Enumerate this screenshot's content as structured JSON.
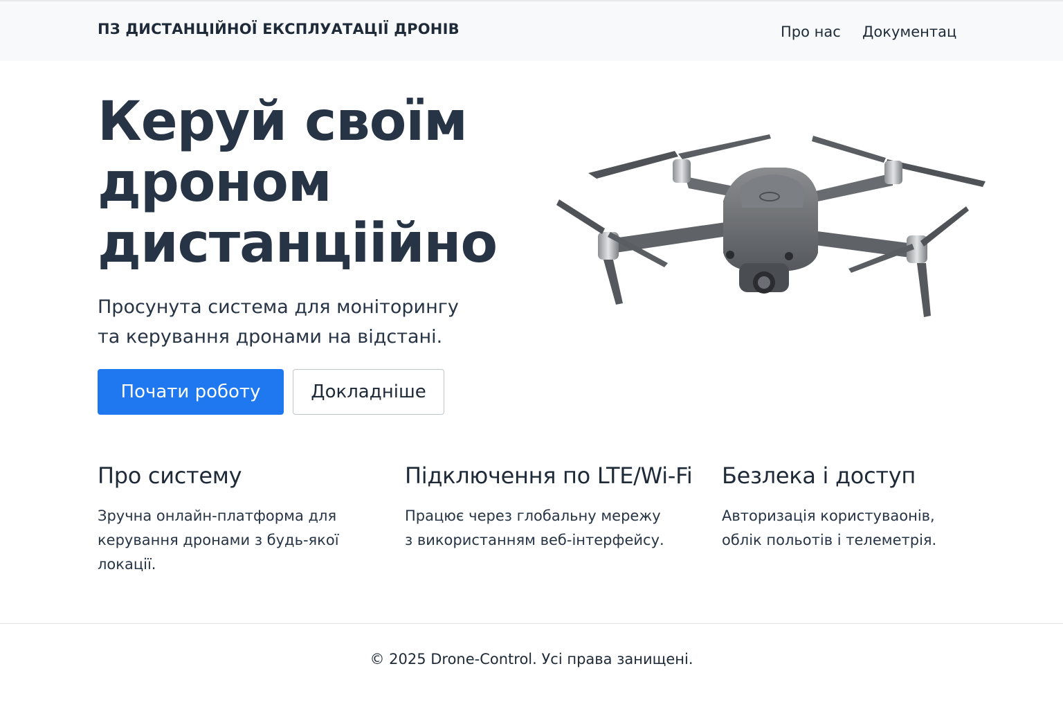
{
  "nav": {
    "brand": "ПЗ ДИСТАНЦІЙНОЇ ЕКСПЛУАТАЦІЇ ДРОНІВ",
    "links": [
      "Про нас",
      "Документац"
    ]
  },
  "hero": {
    "title_lines": [
      "Керуй своїм",
      "дроном",
      "дистанціійно"
    ],
    "subtitle_lines": [
      "Просунута система для моніторингу",
      "та керування дронами на відстані."
    ],
    "primary_button": "Почати роботу",
    "secondary_button": "Докладніше",
    "image_icon": "drone-image"
  },
  "features": [
    {
      "title": "Про систему",
      "lines": [
        "Зручна онлайн-платформа для",
        "керування дронами з будь-якої",
        "локації."
      ]
    },
    {
      "title": "Підключення по LTE/Wi-Fi",
      "lines": [
        "Працює через глобальну мережу",
        "з використанням веб-інтерфейсу."
      ]
    },
    {
      "title": "Безлека і доступ",
      "lines": [
        "Авторизація користуваонів,",
        "облік польотів і телеметрія."
      ]
    }
  ],
  "footer": {
    "text": "© 2025 Drone-Control. Усі права занищені."
  },
  "colors": {
    "primary": "#1f78f0",
    "heading": "#263445",
    "navbar_bg": "#f8f9fb"
  }
}
